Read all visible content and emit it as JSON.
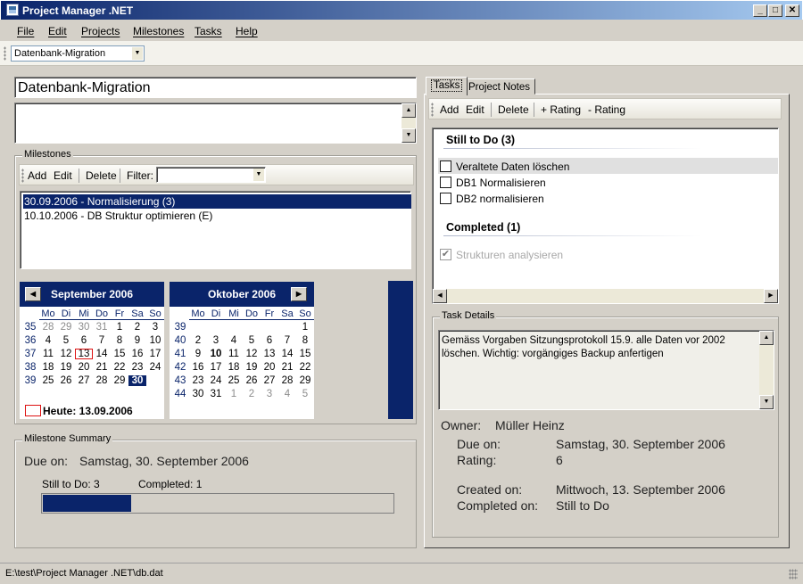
{
  "window": {
    "title": "Project Manager .NET",
    "min_icon": "minimize-icon",
    "max_icon": "maximize-icon",
    "close_icon": "close-icon"
  },
  "menu": [
    "File",
    "Edit",
    "Projects",
    "Milestones",
    "Tasks",
    "Help"
  ],
  "toolbar": {
    "project_selected": "Datenbank-Migration"
  },
  "project": {
    "title": "Datenbank-Migration",
    "description": ""
  },
  "milestones": {
    "group_label": "Milestones",
    "add": "Add",
    "edit": "Edit",
    "delete": "Delete",
    "filter_label": "Filter:",
    "filter_value": "",
    "items": [
      "30.09.2006 - Normalisierung (3)",
      "10.10.2006 - DB Struktur optimieren (E)"
    ],
    "selected_index": 0
  },
  "calendar": {
    "sep": {
      "title": "September 2006",
      "weekdays": [
        "Mo",
        "Di",
        "Mi",
        "Do",
        "Fr",
        "Sa",
        "So"
      ],
      "weeks": [
        "35",
        "36",
        "37",
        "38",
        "39"
      ],
      "rows": [
        [
          "28",
          "29",
          "30",
          "31",
          "1",
          "2",
          "3"
        ],
        [
          "4",
          "5",
          "6",
          "7",
          "8",
          "9",
          "10"
        ],
        [
          "11",
          "12",
          "13",
          "14",
          "15",
          "16",
          "17"
        ],
        [
          "18",
          "19",
          "20",
          "21",
          "22",
          "23",
          "24"
        ],
        [
          "25",
          "26",
          "27",
          "28",
          "29",
          "30",
          ""
        ]
      ]
    },
    "oct": {
      "title": "Oktober 2006",
      "weekdays": [
        "Mo",
        "Di",
        "Mi",
        "Do",
        "Fr",
        "Sa",
        "So"
      ],
      "weeks": [
        "39",
        "40",
        "41",
        "42",
        "43",
        "44"
      ],
      "rows": [
        [
          "",
          "",
          "",
          "",
          "",
          "",
          "1"
        ],
        [
          "2",
          "3",
          "4",
          "5",
          "6",
          "7",
          "8"
        ],
        [
          "9",
          "10",
          "11",
          "12",
          "13",
          "14",
          "15"
        ],
        [
          "16",
          "17",
          "18",
          "19",
          "20",
          "21",
          "22"
        ],
        [
          "23",
          "24",
          "25",
          "26",
          "27",
          "28",
          "29"
        ],
        [
          "30",
          "31",
          "1",
          "2",
          "3",
          "4",
          "5"
        ]
      ]
    },
    "today_label": "Heute: 13.09.2006",
    "today": "13",
    "selected": "30"
  },
  "summary": {
    "group_label": "Milestone Summary",
    "due_label": "Due on:",
    "due_value": "Samstag, 30. September 2006",
    "still_label": "Still to Do: 3",
    "completed_label": "Completed: 1",
    "progress": 0.25
  },
  "tabs": [
    "Tasks",
    "Project Notes"
  ],
  "tasks_toolbar": {
    "add": "Add",
    "edit": "Edit",
    "delete": "Delete",
    "plus": "+ Rating",
    "minus": "- Rating"
  },
  "tasks": {
    "todo_header": "Still to Do (3)",
    "todo": [
      "Veraltete Daten löschen",
      "DB1 Normalisieren",
      "DB2 normalisieren"
    ],
    "done_header": "Completed (1)",
    "done": [
      "Strukturen analysieren"
    ]
  },
  "details": {
    "group_label": "Task Details",
    "text": "Gemäss Vorgaben Sitzungsprotokoll 15.9. alle Daten vor 2002 löschen. Wichtig: vorgängiges Backup anfertigen",
    "owner_label": "Owner:",
    "owner": "Müller Heinz",
    "due_label": "Due on:",
    "due": "Samstag, 30. September 2006",
    "rating_label": "Rating:",
    "rating": "6",
    "created_label": "Created on:",
    "created": "Mittwoch, 13. September 2006",
    "completed_label": "Completed on:",
    "completed": "Still to Do"
  },
  "status": {
    "path": "E:\\test\\Project Manager .NET\\db.dat"
  },
  "colors": {
    "accent": "#0a246a"
  }
}
